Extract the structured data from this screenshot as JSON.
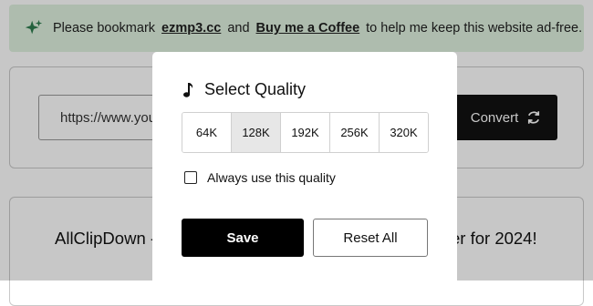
{
  "banner": {
    "text_before": "Please bookmark",
    "site_link": "ezmp3.cc",
    "text_and": "and",
    "coffee_link": "Buy me a Coffee",
    "text_after": "to help me keep this website ad-free."
  },
  "converter": {
    "url_value": "https://www.you",
    "convert_label": "Convert"
  },
  "headline": {
    "left_text": "AllClipDown -",
    "right_text": "er for 2024!"
  },
  "modal": {
    "title": "Select Quality",
    "qualities": [
      "64K",
      "128K",
      "192K",
      "256K",
      "320K"
    ],
    "selected_quality": "128K",
    "checkbox_label": "Always use this quality",
    "checkbox_checked": false,
    "save_label": "Save",
    "reset_label": "Reset All"
  },
  "colors": {
    "banner_bg": "#dff1df",
    "accent_dark": "#111111",
    "selected_option_bg": "#e7e7e7"
  },
  "icons": {
    "banner": "sparkle-icon",
    "convert": "refresh-icon",
    "title": "music-note-icon"
  }
}
